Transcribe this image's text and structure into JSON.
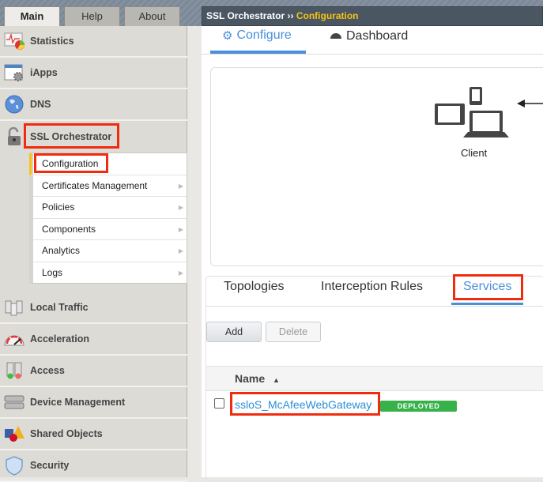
{
  "top_tabs": [
    {
      "label": "Main",
      "active": true
    },
    {
      "label": "Help"
    },
    {
      "label": "About"
    }
  ],
  "sidebar": {
    "items": [
      {
        "label": "Statistics",
        "icon": "statistics-chart-icon"
      },
      {
        "label": "iApps",
        "icon": "iapps-gear-icon"
      },
      {
        "label": "DNS",
        "icon": "globe-icon"
      },
      {
        "label": "SSL Orchestrator",
        "icon": "padlock-icon",
        "expanded": true
      },
      {
        "label": "Local Traffic",
        "icon": "servers-icon"
      },
      {
        "label": "Acceleration",
        "icon": "speedometer-icon"
      },
      {
        "label": "Access",
        "icon": "access-servers-icon"
      },
      {
        "label": "Device Management",
        "icon": "device-stack-icon"
      },
      {
        "label": "Shared Objects",
        "icon": "shapes-icon"
      },
      {
        "label": "Security",
        "icon": "shield-icon"
      }
    ],
    "submenu": [
      "Configuration",
      "Certificates Management",
      "Policies",
      "Components",
      "Analytics",
      "Logs"
    ]
  },
  "header": {
    "section": "SSL Orchestrator",
    "separator": "››",
    "current": "Configuration"
  },
  "content_tabs": [
    {
      "label": "Configure",
      "active": true
    },
    {
      "label": "Dashboard"
    }
  ],
  "diagram": {
    "client_label": "Client"
  },
  "sub_tabs": [
    {
      "label": "Topologies"
    },
    {
      "label": "Interception Rules"
    },
    {
      "label": "Services",
      "active": true
    }
  ],
  "buttons": {
    "add": "Add",
    "delete": "Delete"
  },
  "table": {
    "columns": [
      "Name"
    ],
    "sort": "ascending",
    "rows": [
      {
        "name": "ssloS_McAfeeWebGateway",
        "status": "DEPLOYED"
      }
    ]
  },
  "colors": {
    "accent": "#4a8fdc",
    "highlight": "#f12b0e",
    "deployed": "#37b24a",
    "breadcrumb_current": "#f7c310"
  }
}
